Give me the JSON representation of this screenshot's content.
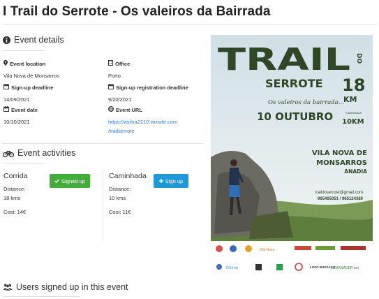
{
  "page": {
    "title": "I Trail do Serrote - Os valeiros da Bairrada"
  },
  "event_details": {
    "heading": "Event details",
    "location": {
      "label": "Event location",
      "value": "Vila Nova de Monsarros"
    },
    "office": {
      "label": "Office",
      "value": "Porto"
    },
    "signup_deadline": {
      "label": "Sign-up deadline",
      "value": "14/09/2021"
    },
    "signup_registration_deadline": {
      "label": "Sign-up registration deadline",
      "value": "9/20/2021"
    },
    "event_date": {
      "label": "Event date",
      "value": "10/10/2021"
    },
    "event_url": {
      "label": "Event URL",
      "value_line1": "https://asilva2210.wixsite.com",
      "value_line2": "/trailserrote"
    }
  },
  "activities": {
    "heading": "Event activities",
    "items": [
      {
        "name": "Corrida",
        "distance_label": "Distance:",
        "distance": "18 kms",
        "cost": "Cost: 14€",
        "button_label": "Signed up",
        "button_state": "signed",
        "button_color": "#43ac3d"
      },
      {
        "name": "Caminhada",
        "distance_label": "Distance:",
        "distance": "10 kms",
        "cost": "Cost: 11€",
        "button_label": "Sign up",
        "button_state": "available",
        "button_color": "#1f9ad6"
      }
    ]
  },
  "users": {
    "heading": "Users signed up in this event"
  },
  "poster": {
    "title_line1": "TRAIL",
    "title_do": "DO",
    "title_line2": "SERROTE",
    "distance_big": "18",
    "distance_big_unit": "KM",
    "subtitle": "Os valeiros da bairrada...",
    "date": "10 OUTUBRO",
    "walk_label": "CAMINHADA",
    "walk_distance": "10KM",
    "place_line1": "VILA NOVA DE",
    "place_line2": "MONSARROS",
    "place_line3": "ANADIA",
    "email": "traildoserrote@gmail.com",
    "phones": "965465051 / 965124380",
    "sponsor_1": "Vila Nova",
    "sponsor_2": "fisiene",
    "sponsor_3": "LUSO BUSSACO",
    "sponsor_4": "fullMANAGER.net"
  }
}
